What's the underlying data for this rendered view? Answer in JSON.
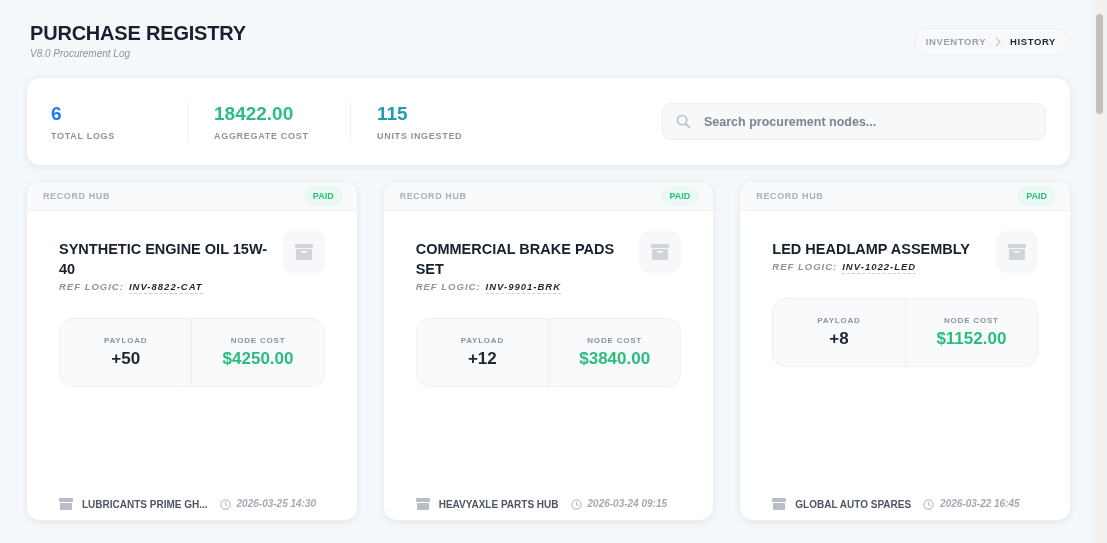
{
  "header": {
    "title": "PURCHASE REGISTRY",
    "subtitle": "V8.0 Procurement Log"
  },
  "breadcrumb": [
    {
      "label": "INVENTORY",
      "selected": false
    },
    {
      "label": "HISTORY",
      "selected": true
    }
  ],
  "stats": [
    {
      "value": "6",
      "label": "TOTAL LOGS",
      "color": "#1a7cf0"
    },
    {
      "value": "18422.00",
      "label": "AGGREGATE COST",
      "color": "#2bbd7e"
    },
    {
      "value": "115",
      "label": "UNITS INGESTED",
      "color": "#1f9bb0"
    }
  ],
  "search": {
    "placeholder": "Search procurement nodes..."
  },
  "records": [
    {
      "hub": "RECORD HUB",
      "status": "PAID",
      "title": "SYNTHETIC ENGINE OIL 15W-40",
      "ref_label": "REF LOGIC:",
      "ref": "INV-8822-CAT",
      "payload_label": "PAYLOAD",
      "payload": "+50",
      "cost_label": "NODE COST",
      "cost": "$4250.00",
      "vendor": "LUBRICANTS PRIME GH...",
      "date": "2026-03-25 14:30"
    },
    {
      "hub": "RECORD HUB",
      "status": "PAID",
      "title": "COMMERCIAL BRAKE PADS SET",
      "ref_label": "REF LOGIC:",
      "ref": "INV-9901-BRK",
      "payload_label": "PAYLOAD",
      "payload": "+12",
      "cost_label": "NODE COST",
      "cost": "$3840.00",
      "vendor": "HEAVYAXLE PARTS HUB",
      "date": "2026-03-24 09:15"
    },
    {
      "hub": "RECORD HUB",
      "status": "PAID",
      "title": "LED HEADLAMP ASSEMBLY",
      "ref_label": "REF LOGIC:",
      "ref": "INV-1022-LED",
      "payload_label": "PAYLOAD",
      "payload": "+8",
      "cost_label": "NODE COST",
      "cost": "$1152.00",
      "vendor": "GLOBAL AUTO SPARES",
      "date": "2026-03-22 16:45"
    }
  ]
}
